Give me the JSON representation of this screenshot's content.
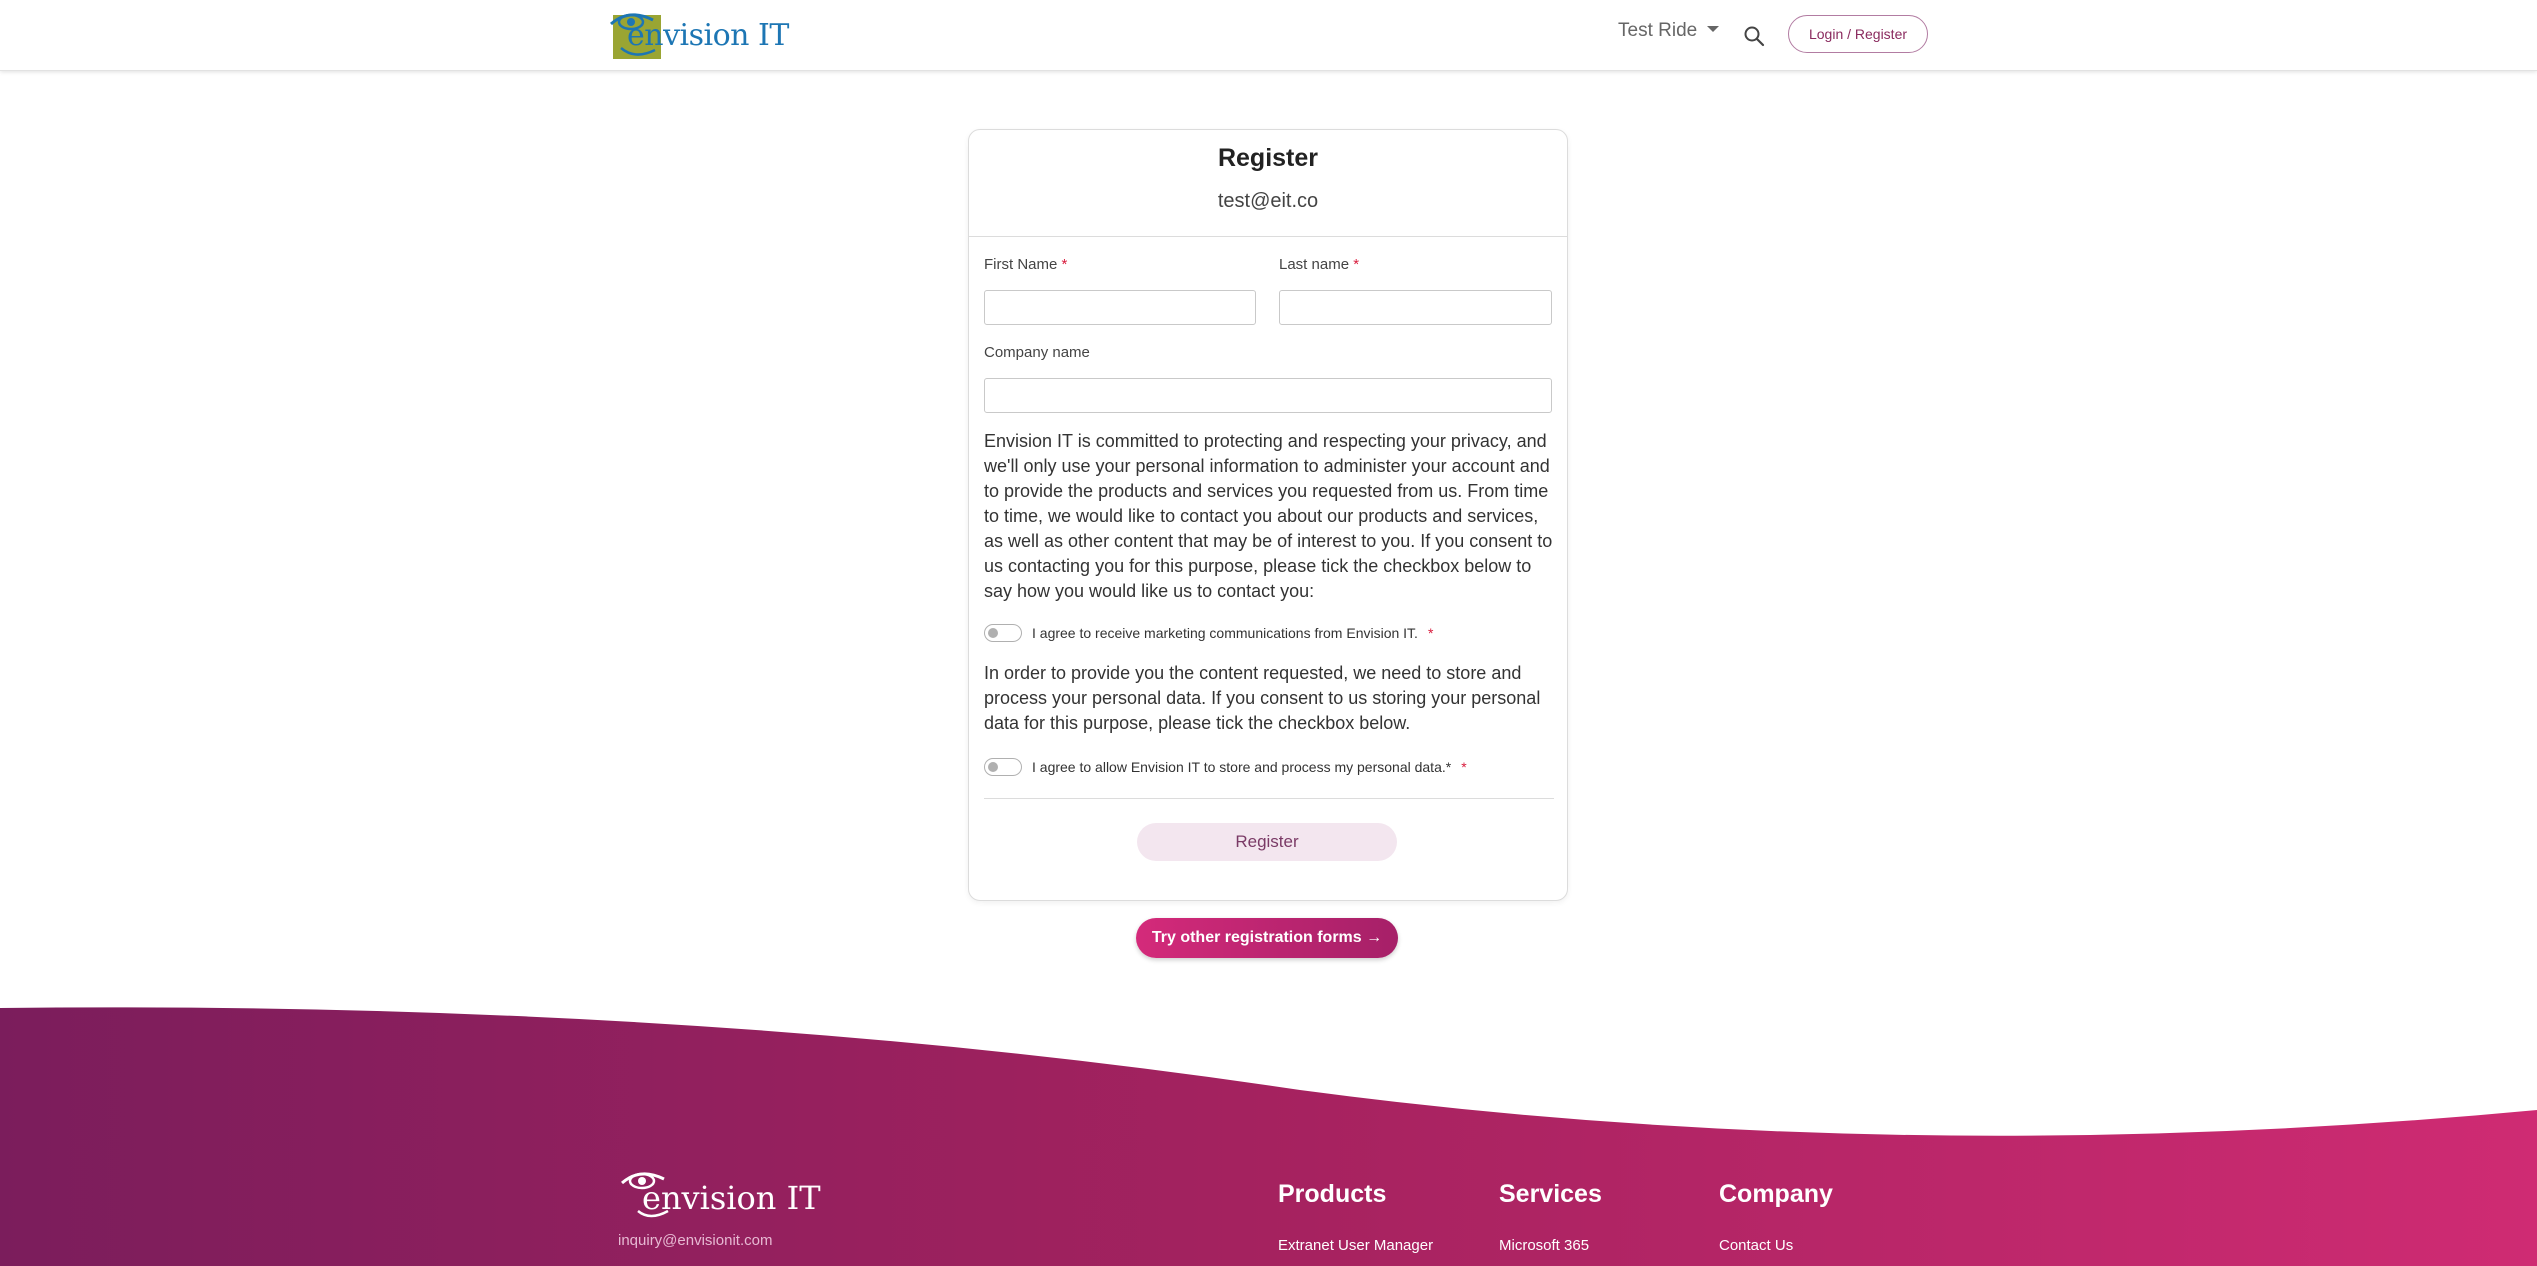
{
  "header": {
    "logo_text": "envision IT",
    "nav_item": "Test Ride",
    "login_label": "Login / Register"
  },
  "card": {
    "title": "Register",
    "email": "test@eit.co",
    "first_name_label": "First Name",
    "last_name_label": "Last name",
    "company_label": "Company name",
    "required_mark": "*",
    "first_name_value": "",
    "last_name_value": "",
    "company_value": "",
    "privacy_text": "Envision IT is committed to protecting and respecting your privacy, and we'll only use your personal information to administer your account and to provide the products and services you requested from us. From time to time, we would like to contact you about our products and services, as well as other content that may be of interest to you. If you consent to us contacting you for this purpose, please tick the checkbox below to say how you would like us to contact you:",
    "marketing_consent_label": "I agree to receive marketing communications from Envision IT.",
    "storage_text": "In order to provide you the content requested, we need to store and process your personal data. If you consent to us storing your personal data for this purpose, please tick the checkbox below.",
    "storage_consent_label": "I agree to allow Envision IT to store and process my personal data.*",
    "register_label": "Register"
  },
  "try_other_label": "Try other registration forms →",
  "footer": {
    "logo_text": "envision IT",
    "email": "inquiry@envisionit.com",
    "columns": [
      {
        "title": "Products",
        "first_link": "Extranet User Manager"
      },
      {
        "title": "Services",
        "first_link": "Microsoft 365"
      },
      {
        "title": "Company",
        "first_link": "Contact Us"
      }
    ]
  },
  "colors": {
    "brand_magenta": "#a62068",
    "brand_blue": "#1d76b4",
    "brand_olive": "#9aa533"
  },
  "icons": [
    "eye-logo-icon",
    "search-icon",
    "chevron-down-icon"
  ]
}
